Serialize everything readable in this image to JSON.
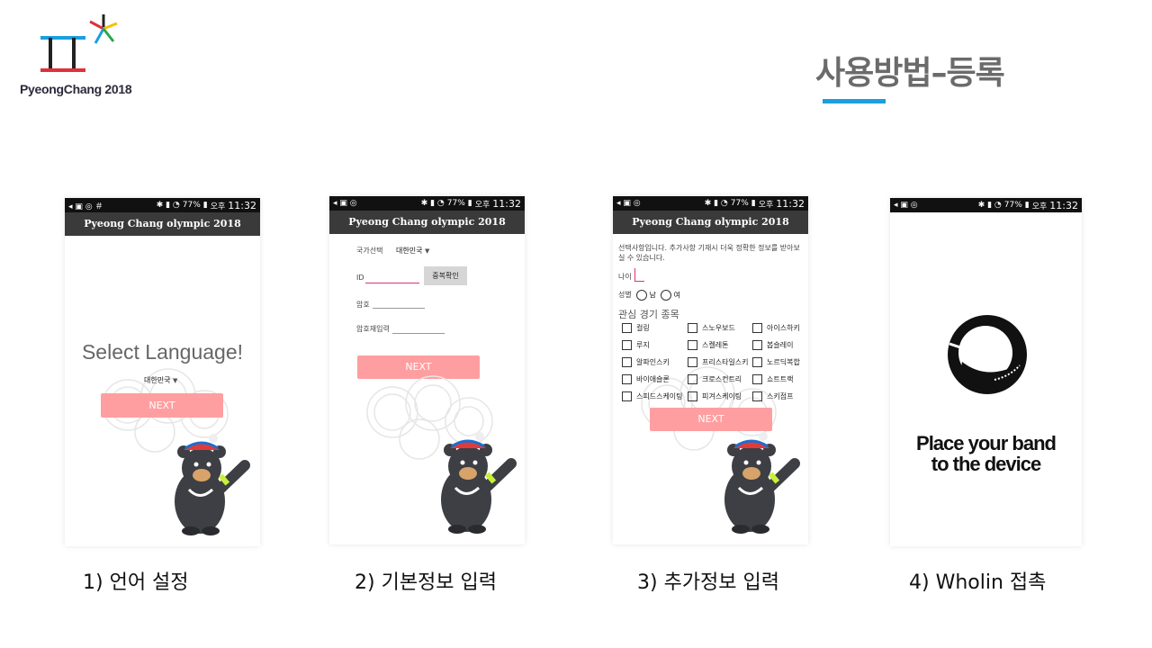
{
  "logo": {
    "text": "PyeongChang 2018"
  },
  "slide": {
    "title": "사용방법–등록"
  },
  "status_bar": {
    "battery": "77%",
    "ampm": "오후",
    "time": "11:32"
  },
  "app_title": "Pyeong Chang olympic 2018",
  "screen1": {
    "heading": "Select Language!",
    "language": "대한민국",
    "next": "NEXT",
    "caption": "1)  언어 설정"
  },
  "screen2": {
    "country_label": "국가선택",
    "country_value": "대한민국",
    "id_label": "ID",
    "dup_check": "중복확인",
    "password_label": "암호",
    "password_confirm_label": "암호재입력",
    "next": "NEXT",
    "caption": "2)  기본정보 입력"
  },
  "screen3": {
    "intro": "선택사항입니다. 추가사항 기재시 더욱 정확한 정보를 받아보실 수 있습니다.",
    "age_label": "나이",
    "gender_label": "성별",
    "male": "남",
    "female": "여",
    "sports_heading": "관심 경기 종목",
    "sports": [
      "컬링",
      "스노우보드",
      "아이스하키",
      "루지",
      "스켈레톤",
      "봅슬레이",
      "알파인스키",
      "프리스타일스키",
      "노르딕복합",
      "바이애슬론",
      "크로스컨트리",
      "쇼트트랙",
      "스피드스케이팅",
      "피겨스케이팅",
      "스키점프"
    ],
    "next": "NEXT",
    "caption": "3)  추가정보 입력"
  },
  "screen4": {
    "line1": "Place your band",
    "line2": "to the device",
    "caption": "4)  Wholin 접촉"
  }
}
